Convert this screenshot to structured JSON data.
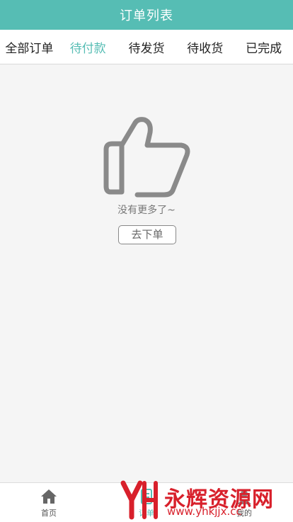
{
  "header": {
    "title": "订单列表"
  },
  "tabs": [
    {
      "label": "全部订单"
    },
    {
      "label": "待付款"
    },
    {
      "label": "待发货"
    },
    {
      "label": "待收货"
    },
    {
      "label": "已完成"
    }
  ],
  "active_tab": "待付款",
  "empty": {
    "icon": "thumbs-up-icon",
    "text": "没有更多了~",
    "button_label": "去下单"
  },
  "bottom_nav": [
    {
      "label": "首页",
      "icon": "home-icon"
    },
    {
      "label": "订单",
      "icon": "order-icon"
    },
    {
      "label": "我的",
      "icon": "user-icon"
    }
  ],
  "watermark": {
    "name": "永辉资源网",
    "url": "www.yhkjjx.cc"
  },
  "colors": {
    "accent": "#56bdb4",
    "watermark": "#d8202b"
  }
}
